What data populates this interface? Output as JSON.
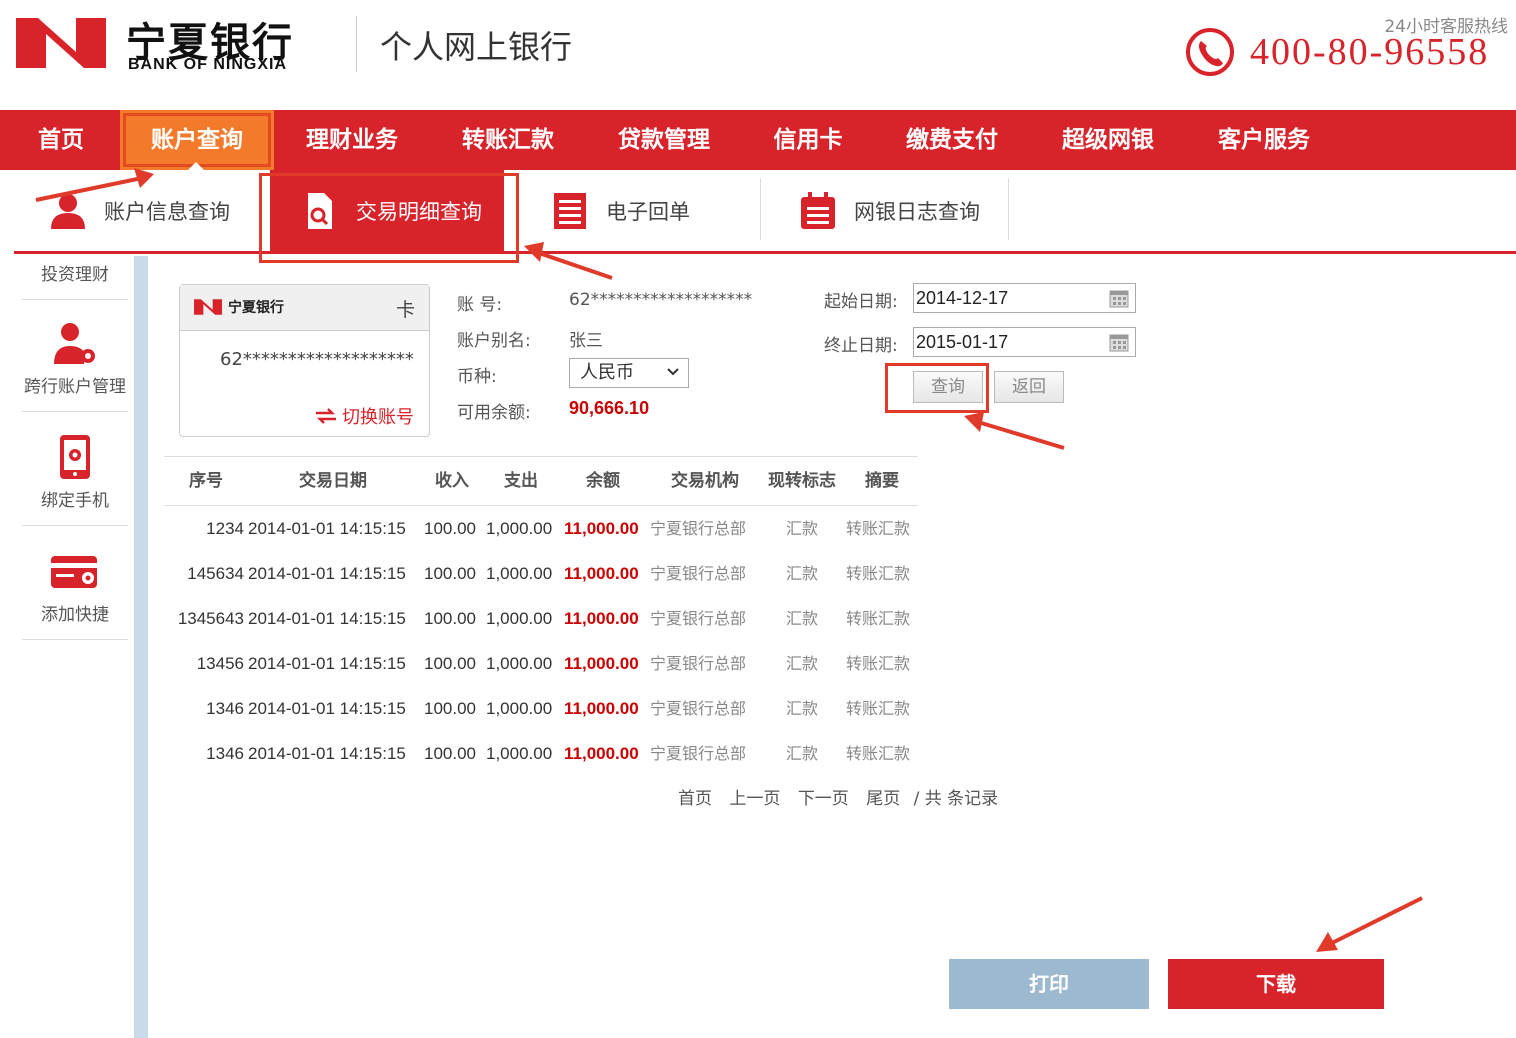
{
  "header": {
    "bank_name_cn": "宁夏银行",
    "bank_name_en": "BANK OF NINGXIA",
    "site_title": "个人网上银行",
    "hotline_label": "24小时客服热线",
    "hotline_number": "400-80-96558"
  },
  "nav": {
    "items": [
      {
        "label": "首页"
      },
      {
        "label": "账户查询"
      },
      {
        "label": "理财业务"
      },
      {
        "label": "转账汇款"
      },
      {
        "label": "贷款管理"
      },
      {
        "label": "信用卡"
      },
      {
        "label": "缴费支付"
      },
      {
        "label": "超级网银"
      },
      {
        "label": "客户服务"
      }
    ],
    "active_index": 1
  },
  "subnav": {
    "items": [
      {
        "label": "账户信息查询",
        "icon": "user-icon"
      },
      {
        "label": "交易明细查询",
        "icon": "document-search-icon"
      },
      {
        "label": "电子回单",
        "icon": "receipt-icon"
      },
      {
        "label": "网银日志查询",
        "icon": "calendar-list-icon"
      }
    ],
    "active_index": 1
  },
  "sidebar": {
    "items": [
      {
        "label": "投资理财",
        "icon": ""
      },
      {
        "label": "跨行账户管理",
        "icon": "user-gear-icon"
      },
      {
        "label": "绑定手机",
        "icon": "mobile-icon"
      },
      {
        "label": "添加快捷",
        "icon": "card-gear-icon"
      }
    ]
  },
  "card": {
    "bank_label": "宁夏银行",
    "tag": "卡",
    "number": "62*******************",
    "switch_label": "切换账号"
  },
  "account": {
    "number_label": "账  号:",
    "number_value": "62*******************",
    "alias_label": "账户别名:",
    "alias_value": "张三",
    "currency_label": "币种:",
    "currency_value": "人民币",
    "balance_label": "可用余额:",
    "balance_value": "90,666.10"
  },
  "query": {
    "start_label": "起始日期:",
    "start_value": "2014-12-17",
    "end_label": "终止日期:",
    "end_value": "2015-01-17",
    "query_button": "查询",
    "back_button": "返回"
  },
  "table": {
    "columns": [
      "序号",
      "交易日期",
      "收入",
      "支出",
      "余额",
      "交易机构",
      "现转标志",
      "摘要"
    ],
    "rows": [
      [
        "1234",
        "2014-01-01 14:15:15",
        "100.00",
        "1,000.00",
        "11,000.00",
        "宁夏银行总部",
        "汇款",
        "转账汇款"
      ],
      [
        "145634",
        "2014-01-01 14:15:15",
        "100.00",
        "1,000.00",
        "11,000.00",
        "宁夏银行总部",
        "汇款",
        "转账汇款"
      ],
      [
        "1345643",
        "2014-01-01 14:15:15",
        "100.00",
        "1,000.00",
        "11,000.00",
        "宁夏银行总部",
        "汇款",
        "转账汇款"
      ],
      [
        "13456",
        "2014-01-01 14:15:15",
        "100.00",
        "1,000.00",
        "11,000.00",
        "宁夏银行总部",
        "汇款",
        "转账汇款"
      ],
      [
        "1346",
        "2014-01-01 14:15:15",
        "100.00",
        "1,000.00",
        "11,000.00",
        "宁夏银行总部",
        "汇款",
        "转账汇款"
      ],
      [
        "1346",
        "2014-01-01 14:15:15",
        "100.00",
        "1,000.00",
        "11,000.00",
        "宁夏银行总部",
        "汇款",
        "转账汇款"
      ]
    ]
  },
  "pager": {
    "first": "首页",
    "prev": "上一页",
    "next": "下一页",
    "last": "尾页",
    "total": "/ 共 条记录"
  },
  "actions": {
    "print": "打印",
    "download": "下载"
  },
  "colors": {
    "brand_red": "#d8232a",
    "active_orange": "#f47a2b",
    "print_blue": "#9cb9cf"
  }
}
